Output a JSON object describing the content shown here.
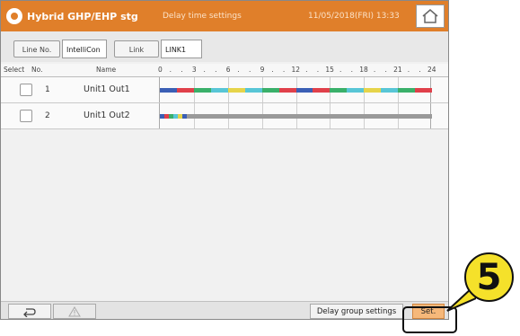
{
  "header": {
    "app_title": "Hybrid GHP/EHP stg",
    "screen_title": "Delay time settings",
    "datetime": "11/05/2018(FRI) 13:33",
    "icons": {
      "logo": "sun-icon",
      "home": "home-icon"
    }
  },
  "toolbar": {
    "line_no_label": "Line No.",
    "line_no_value": "IntelliCon",
    "link_label": "Link",
    "link_value": "LINK1"
  },
  "columns": {
    "select": "Select",
    "no": "No.",
    "name": "Name",
    "ticks": [
      "0",
      ".",
      ".",
      "3",
      ".",
      ".",
      "6",
      ".",
      ".",
      "9",
      ".",
      ".",
      "12",
      ".",
      ".",
      "15",
      ".",
      ".",
      "18",
      ".",
      ".",
      "21",
      ".",
      ".",
      "24"
    ]
  },
  "rows": [
    {
      "no": "1",
      "name": "Unit1 Out1",
      "checked": false
    },
    {
      "no": "2",
      "name": "Unit1 Out2",
      "checked": false
    }
  ],
  "colors": {
    "header": "#e07f2a",
    "blue": "#3b5fb5",
    "red": "#e0404a",
    "green": "#3ab06a",
    "cyan": "#58c6d6",
    "yellow": "#e6d44a",
    "gray": "#9a9a9a",
    "set_button": "#f6b87a",
    "badge": "#f5e12a"
  },
  "footer": {
    "back_icon": "back-arrow-icon",
    "warning_icon": "warning-icon",
    "delay_group_label": "Delay group settings",
    "set_label": "Set."
  },
  "annotation": {
    "number": "5"
  }
}
